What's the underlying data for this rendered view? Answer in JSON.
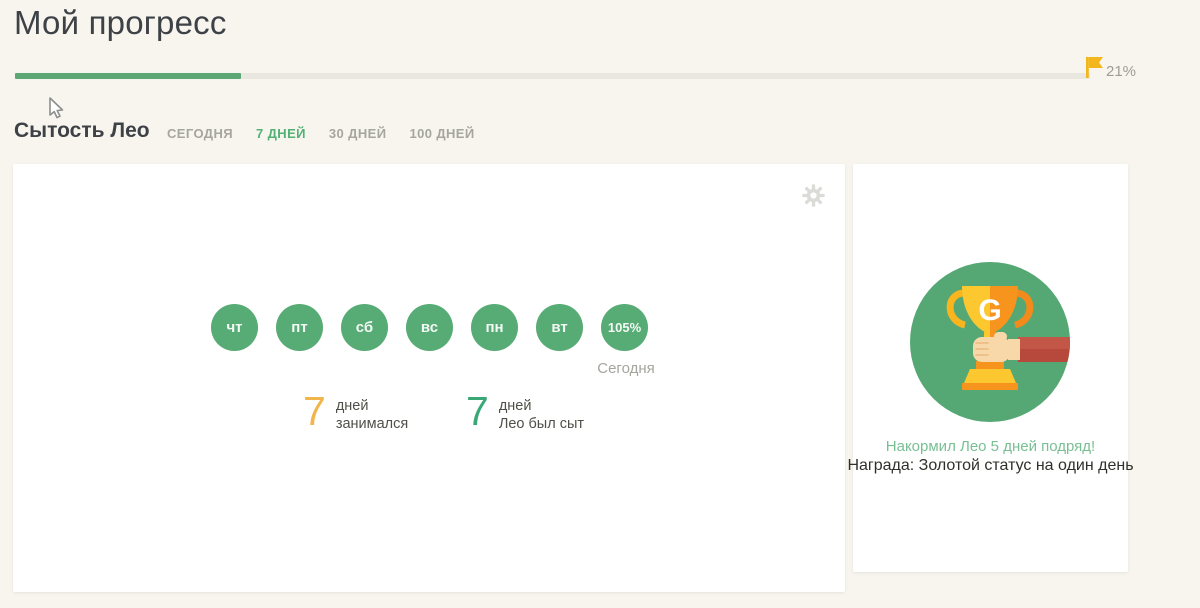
{
  "header": {
    "title": "Мой прогресс",
    "progress_percent": 21,
    "progress_label": "21%"
  },
  "section": {
    "title": "Сытость Лео",
    "tabs": [
      {
        "label": "СЕГОДНЯ",
        "active": false
      },
      {
        "label": "7 ДНЕЙ",
        "active": true
      },
      {
        "label": "30 ДНЕЙ",
        "active": false
      },
      {
        "label": "100 ДНЕЙ",
        "active": false
      }
    ]
  },
  "week": {
    "days": [
      "чт",
      "пт",
      "сб",
      "вс",
      "пн",
      "вт",
      "105%"
    ],
    "today_label": "Сегодня",
    "stats": [
      {
        "value": "7",
        "lines": [
          "дней",
          "занимался"
        ]
      },
      {
        "value": "7",
        "lines": [
          "дней",
          "Лео был сыт"
        ]
      }
    ]
  },
  "reward": {
    "trophy_letter": "G",
    "title": "Накормил Лео 5 дней подряд!",
    "subtitle": "Награда: Золотой статус на один день"
  },
  "colors": {
    "background": "#f7f5ee",
    "panel": "#ffffff",
    "accent_green": "#53b175",
    "circle_green": "#57ab74",
    "badge_green": "#55a873",
    "progress_green": "#5ca774",
    "amber": "#f2b54c",
    "flag_yellow": "#f3b71d",
    "muted_text": "#a6a69e"
  }
}
